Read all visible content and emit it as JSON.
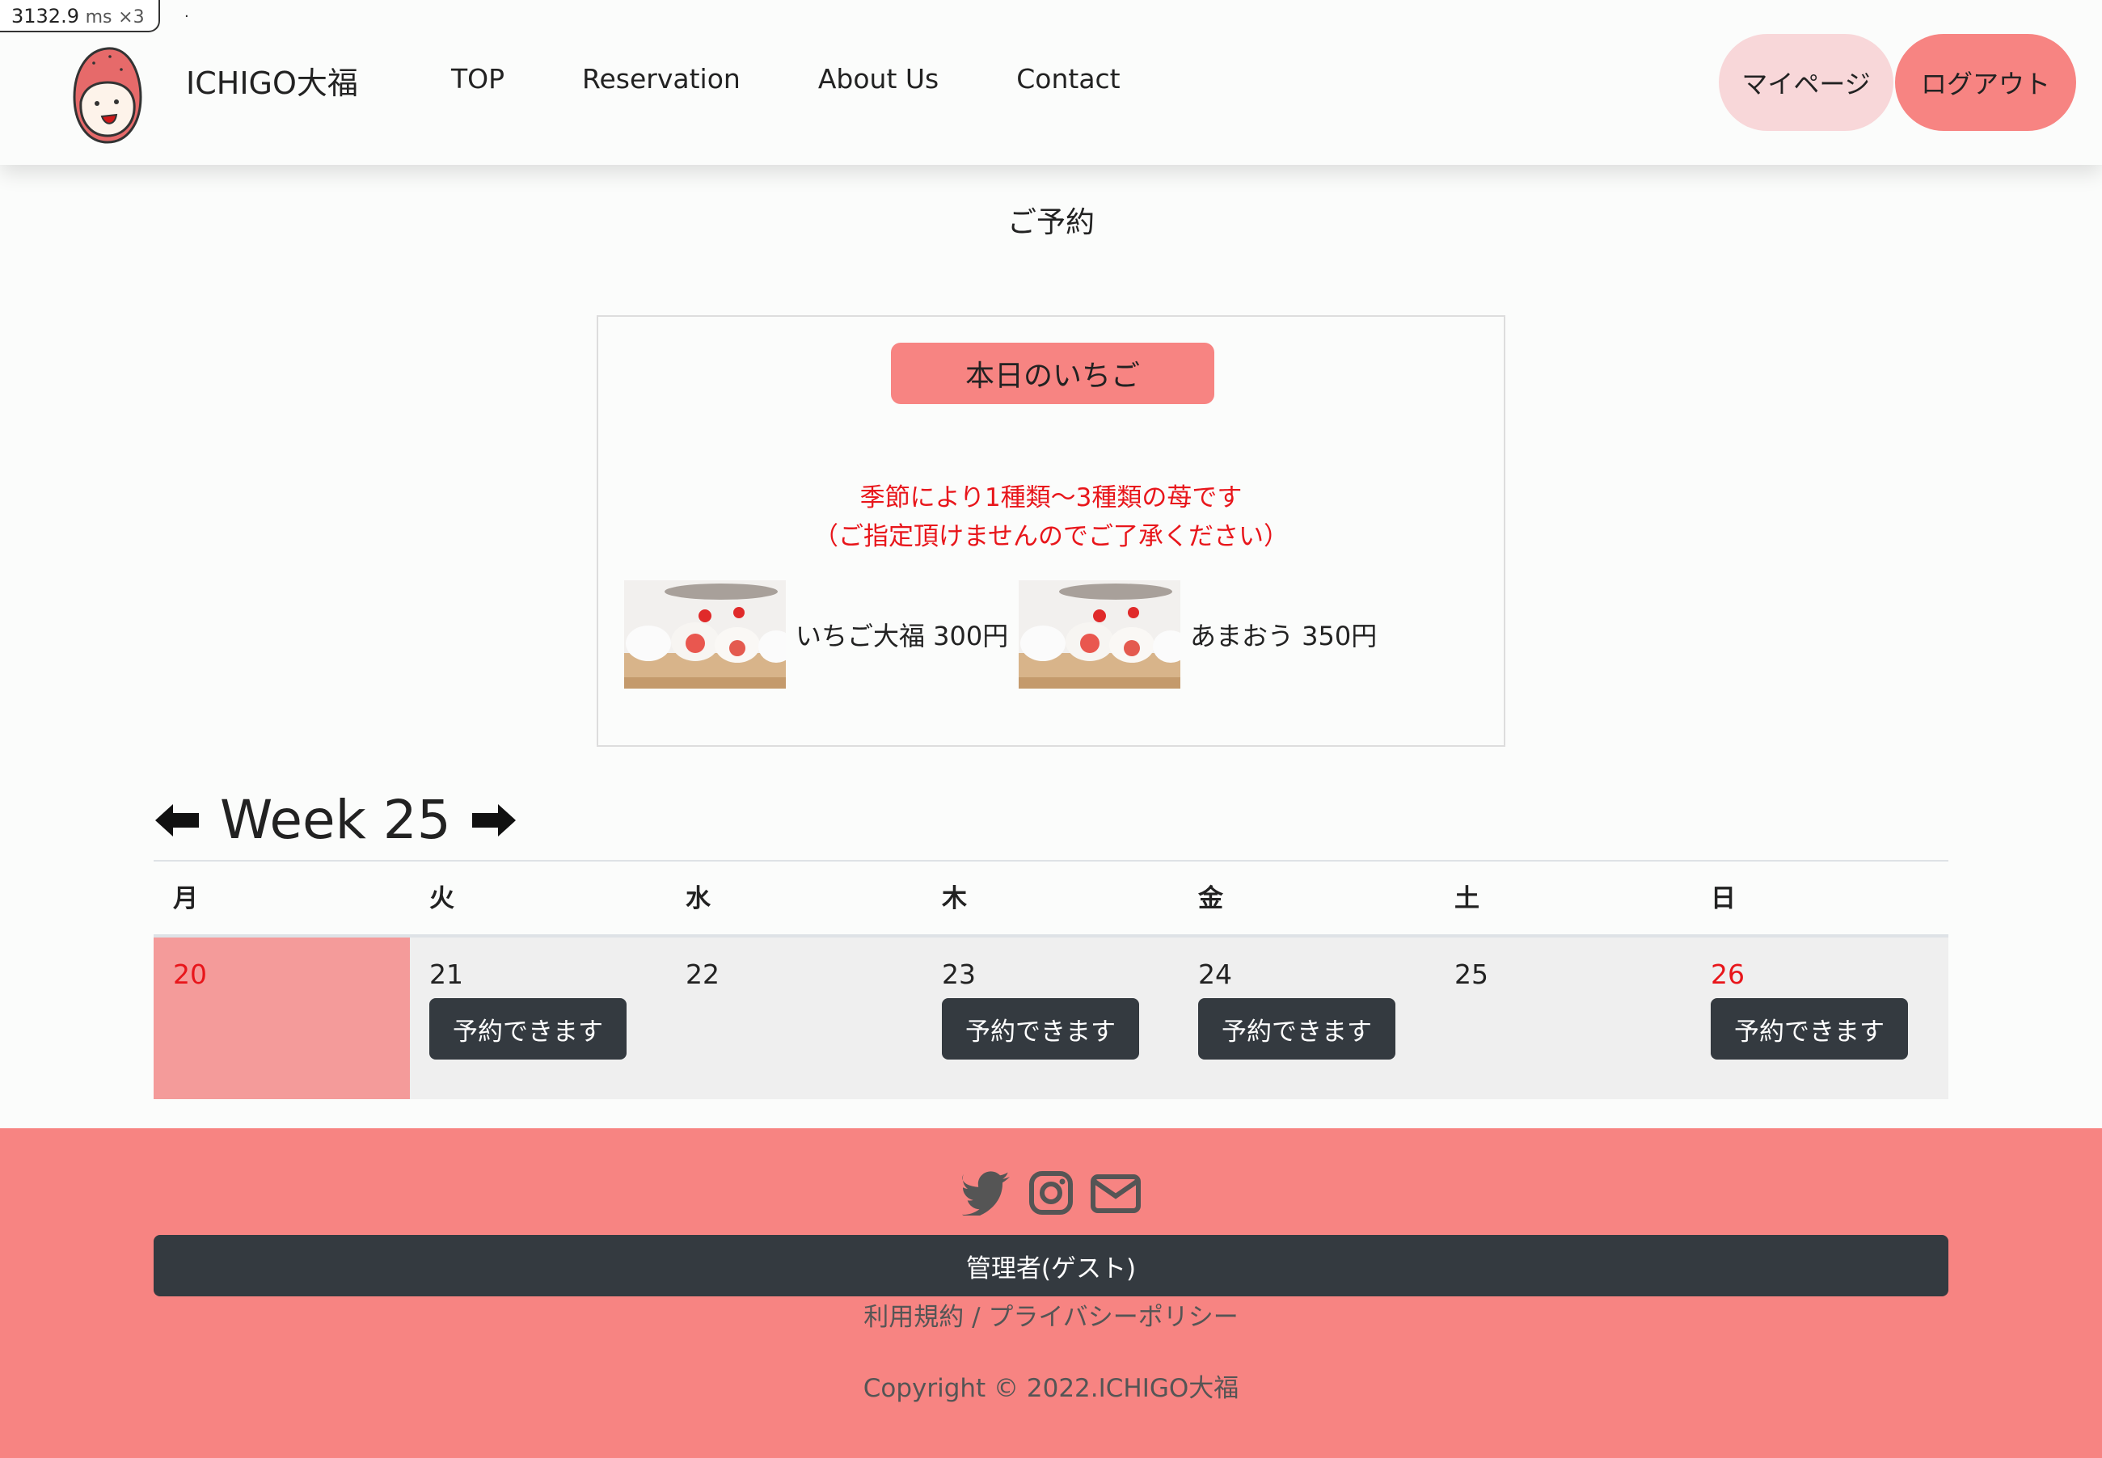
{
  "perf": {
    "time": "3132.9",
    "unit": "ms",
    "multiplier": "×3",
    "dot": "·"
  },
  "header": {
    "brand": "ICHIGO大福",
    "nav": [
      "TOP",
      "Reservation",
      "About Us",
      "Contact"
    ],
    "mypage": "マイページ",
    "logout": "ログアウト"
  },
  "page_title": "ご予約",
  "today": {
    "badge": "本日のいちご",
    "notice_line1": "季節により1種類〜3種類の苺です",
    "notice_line2": "（ご指定頂けませんのでご了承ください）",
    "products": [
      {
        "name": "いちご大福 300円"
      },
      {
        "name": "あまおう 350円"
      }
    ]
  },
  "week": {
    "label": "Week 25"
  },
  "calendar": {
    "headers": [
      "月",
      "火",
      "水",
      "木",
      "金",
      "土",
      "日"
    ],
    "days": [
      {
        "num": "20",
        "red": true,
        "today": true,
        "button": ""
      },
      {
        "num": "21",
        "red": false,
        "today": false,
        "button": "予約できます"
      },
      {
        "num": "22",
        "red": false,
        "today": false,
        "button": ""
      },
      {
        "num": "23",
        "red": false,
        "today": false,
        "button": "予約できます"
      },
      {
        "num": "24",
        "red": false,
        "today": false,
        "button": "予約できます"
      },
      {
        "num": "25",
        "red": false,
        "today": false,
        "button": ""
      },
      {
        "num": "26",
        "red": true,
        "today": false,
        "button": "予約できます"
      }
    ]
  },
  "footer": {
    "icons": [
      "twitter-icon",
      "instagram-icon",
      "mail-icon"
    ],
    "admin": "管理者(ゲスト)",
    "policy": "利用規約 / プライバシーポリシー",
    "copyright": "Copyright © 2022.ICHIGO大福"
  },
  "colors": {
    "accent": "#f78482",
    "light_accent": "#f8d7d9",
    "today": "#f49b9a",
    "dark": "#343a40",
    "red_text": "#e8161b"
  }
}
